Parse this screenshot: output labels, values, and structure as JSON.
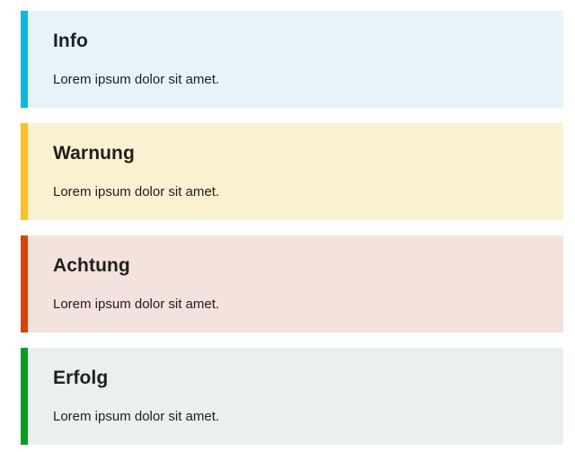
{
  "alerts": [
    {
      "variant": "info",
      "title": "Info",
      "text": "Lorem ipsum dolor sit amet.",
      "accent_color": "#12b6e0",
      "background_color": "#e6f4fa"
    },
    {
      "variant": "warning",
      "title": "Warnung",
      "text": "Lorem ipsum dolor sit amet.",
      "accent_color": "#fbbf2c",
      "background_color": "#f9f1d0"
    },
    {
      "variant": "danger",
      "title": "Achtung",
      "text": "Lorem ipsum dolor sit amet.",
      "accent_color": "#d6420f",
      "background_color": "#f4e2dc"
    },
    {
      "variant": "success",
      "title": "Erfolg",
      "text": "Lorem ipsum dolor sit amet.",
      "accent_color": "#0c9c22",
      "background_color": "#ebf0ec"
    }
  ]
}
